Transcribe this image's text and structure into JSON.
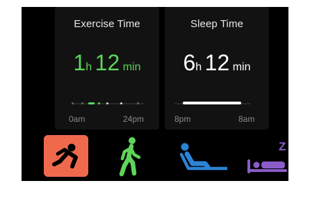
{
  "exercise": {
    "title": "Exercise Time",
    "hours": "1",
    "hours_unit": "h",
    "minutes": "12",
    "minutes_unit": "min",
    "range_start": "0am",
    "range_end": "24pm",
    "color": "#5fd35a"
  },
  "sleep": {
    "title": "Sleep Time",
    "hours": "6",
    "hours_unit": "h",
    "minutes": "12",
    "minutes_unit": "min",
    "range_start": "8pm",
    "range_end": "8am",
    "color": "#ffffff"
  },
  "activities": [
    {
      "icon": "falling-person-icon",
      "selected": true,
      "color": "#ef6a4d"
    },
    {
      "icon": "walking-person-icon",
      "selected": false,
      "color": "#5fd35a"
    },
    {
      "icon": "reclining-person-icon",
      "selected": false,
      "color": "#2b83d6"
    },
    {
      "icon": "sleeping-person-icon",
      "selected": false,
      "color": "#8b5cc8",
      "badge": "Z"
    }
  ]
}
